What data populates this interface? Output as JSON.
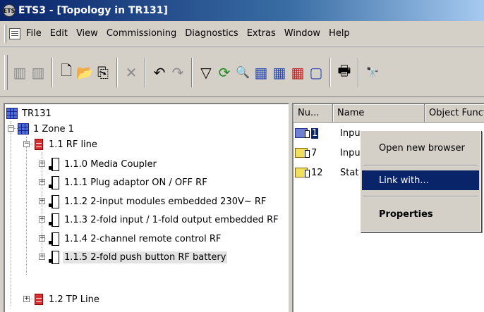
{
  "window": {
    "title": "ETS3 - [Topology in TR131]",
    "icon": "ets-app-icon"
  },
  "menubar": {
    "icon": "document-icon",
    "items": [
      {
        "label": "File"
      },
      {
        "label": "Edit"
      },
      {
        "label": "View"
      },
      {
        "label": "Commissioning"
      },
      {
        "label": "Diagnostics"
      },
      {
        "label": "Extras"
      },
      {
        "label": "Window"
      },
      {
        "label": "Help"
      }
    ]
  },
  "toolbar": {
    "buttons": [
      {
        "icon": "project-open-icon",
        "glyph": "▥",
        "enabled": false
      },
      {
        "icon": "project-close-icon",
        "glyph": "▥",
        "enabled": false
      },
      {
        "icon": "new-icon",
        "glyph": "🗋",
        "enabled": true
      },
      {
        "icon": "open-dropdown-icon",
        "glyph": "📂",
        "enabled": true
      },
      {
        "icon": "copy-dropdown-icon",
        "glyph": "⎘",
        "enabled": true
      },
      {
        "icon": "delete-icon",
        "glyph": "✕",
        "enabled": false
      },
      {
        "icon": "undo-icon",
        "glyph": "↶",
        "enabled": true
      },
      {
        "icon": "redo-icon",
        "glyph": "↷",
        "enabled": false
      },
      {
        "icon": "filter-icon",
        "glyph": "▽",
        "enabled": true
      },
      {
        "icon": "refresh-icon",
        "glyph": "⟳",
        "enabled": true
      },
      {
        "icon": "search-icon",
        "glyph": "🔍",
        "enabled": true
      },
      {
        "icon": "building-view-icon",
        "glyph": "▦",
        "enabled": true
      },
      {
        "icon": "topology-view-icon",
        "glyph": "▦",
        "enabled": true
      },
      {
        "icon": "group-address-icon",
        "glyph": "▦",
        "enabled": true
      },
      {
        "icon": "window-icon",
        "glyph": "▢",
        "enabled": true
      },
      {
        "icon": "print-icon",
        "glyph": "🖶",
        "enabled": true
      },
      {
        "icon": "find-icon",
        "glyph": "🔭",
        "enabled": true
      }
    ]
  },
  "tree": {
    "root": {
      "label": "TR131",
      "icon": "topology-icon"
    },
    "nodes": [
      {
        "label": "1 Zone 1",
        "icon": "zone-icon",
        "expanded": true
      },
      {
        "label": "1.1 RF line",
        "icon": "line-icon",
        "expanded": true
      },
      {
        "label": "1.1.0 Media Coupler",
        "icon": "device-icon"
      },
      {
        "label": "1.1.1 Plug adaptor ON / OFF RF",
        "icon": "device-icon"
      },
      {
        "label": "1.1.2 2-input modules embedded 230V~ RF",
        "icon": "device-icon"
      },
      {
        "label": "1.1.3 2-fold input / 1-fold output embedded RF",
        "icon": "device-icon"
      },
      {
        "label": "1.1.4 2-channel remote control RF",
        "icon": "device-icon"
      },
      {
        "label": "1.1.5 2-fold push button RF battery",
        "icon": "device-icon",
        "selected": true
      },
      {
        "label": "1.2 TP Line",
        "icon": "line-icon",
        "expanded": false
      }
    ]
  },
  "list": {
    "columns": [
      {
        "label": "Nu..."
      },
      {
        "label": "Name"
      },
      {
        "label": "Object Functio"
      }
    ],
    "rows": [
      {
        "num": "1",
        "name": "Inpu",
        "selected": true
      },
      {
        "num": "7",
        "name": "Inpu"
      },
      {
        "num": "12",
        "name": "Stat"
      }
    ]
  },
  "context_menu": {
    "items": [
      {
        "label": "Open new browser"
      },
      {
        "label": "Link with...",
        "highlighted": true
      },
      {
        "label": "Properties",
        "bold": true
      }
    ]
  },
  "colors": {
    "selection": "#0a246a",
    "title_start": "#0a246a",
    "title_end": "#a6caf0",
    "face": "#d4d0c8"
  }
}
